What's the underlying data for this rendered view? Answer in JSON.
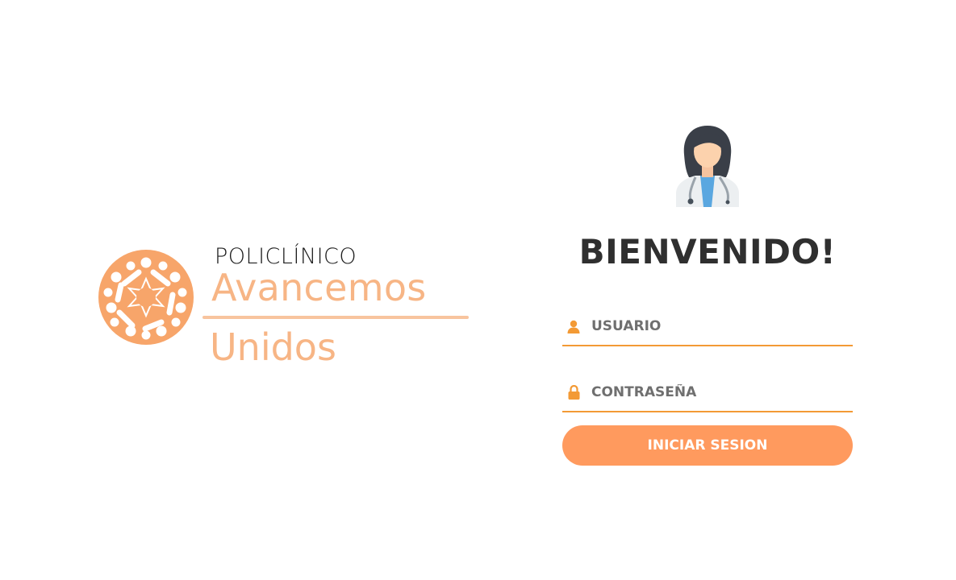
{
  "brand": {
    "line1": "POLICLÍNICO",
    "line2": "Avancemos",
    "line3": "Unidos",
    "logo_color": "#f7b585",
    "logo_icon": "people-circle-emblem-icon"
  },
  "login": {
    "avatar_icon": "doctor-avatar-icon",
    "welcome": "BIENVENIDO!",
    "username": {
      "icon": "user-icon",
      "placeholder": "USUARIO",
      "value": ""
    },
    "password": {
      "icon": "lock-icon",
      "placeholder": "CONTRASEÑA",
      "value": ""
    },
    "submit_label": "INICIAR SESION",
    "accent_color": "#f39a35",
    "button_color": "#ff9a5e"
  }
}
